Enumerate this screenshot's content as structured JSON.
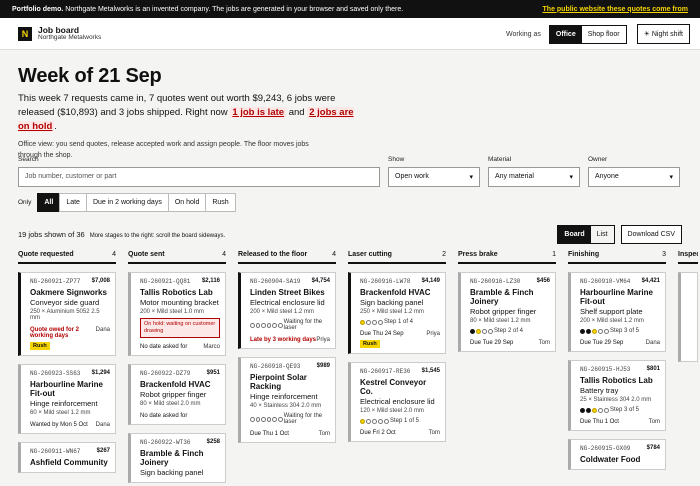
{
  "topbar": {
    "demo_bold": "Portfolio demo.",
    "demo_text": " Northgate Metalworks is an invented company. The jobs are generated in your browser and saved only there.",
    "public_link": "The public website these quotes come from"
  },
  "header": {
    "logo": "N",
    "title": "Job board",
    "subtitle": "Northgate Metalworks",
    "working_as": "Working as",
    "modes": [
      "Office",
      "Shop floor"
    ],
    "night": "☀ Night shift"
  },
  "page": {
    "title": "Week of 21 Sep",
    "summary_a": "This week 7 requests came in, 7 quotes went out worth $9,243, 6 jobs were released ($10,893) and 3 jobs shipped. Right now ",
    "late_flag": "1 job is late",
    "summary_and": " and ",
    "hold_flag": "2 jobs are on hold",
    "summary_end": ".",
    "note": "Office view: you send quotes, release accepted work and assign people. The floor moves jobs through the shop."
  },
  "filters": {
    "search_label": "Search",
    "search_placeholder": "Job number, customer or part",
    "show_label": "Show",
    "show_value": "Open work",
    "material_label": "Material",
    "material_value": "Any material",
    "owner_label": "Owner",
    "owner_value": "Anyone"
  },
  "only": {
    "label": "Only",
    "pills": [
      "All",
      "Late",
      "Due in 2 working days",
      "On hold",
      "Rush"
    ]
  },
  "count": {
    "text": "19 jobs shown of 36",
    "hint": "More stages to the right: scroll the board sideways."
  },
  "view": {
    "board": "Board",
    "list": "List",
    "export": "Download CSV"
  },
  "columns": [
    {
      "name": "Quote requested",
      "count": "4",
      "cards": [
        {
          "id": "NG-260921-ZP77",
          "price": "$7,008",
          "cust": "Oakmere Signworks",
          "desc": "Conveyor side guard",
          "mat": "250 × Aluminium 5052 2.5 mm",
          "late": "Quote owed for 2 working days",
          "who": "Dana",
          "rush": "Rush"
        },
        {
          "id": "NG-260923-SS63",
          "price": "$1,294",
          "cust": "Harbourline Marine Fit-out",
          "desc": "Hinge reinforcement",
          "mat": "60 × Mild steel 1.2 mm",
          "due": "Wanted by Mon 5 Oct",
          "who": "Dana"
        },
        {
          "id": "NG-260911-WN67",
          "price": "$267",
          "cust": "Ashfield Community",
          "desc": "",
          "mat": ""
        }
      ]
    },
    {
      "name": "Quote sent",
      "count": "4",
      "cards": [
        {
          "id": "NG-260921-QQ81",
          "price": "$2,116",
          "cust": "Tallis Robotics Lab",
          "desc": "Motor mounting bracket",
          "mat": "200 × Mild steel 1.0 mm",
          "due": "No date asked for",
          "who": "Marco",
          "hold": "On hold: waiting on customer drawing"
        },
        {
          "id": "NG-260922-DZ79",
          "price": "$951",
          "cust": "Brackenfold HVAC",
          "desc": "Robot gripper finger",
          "mat": "80 × Mild steel 2.0 mm",
          "due": "No date asked for"
        },
        {
          "id": "NG-260922-WT36",
          "price": "$258",
          "cust": "Bramble & Finch Joinery",
          "desc": "Sign backing panel",
          "mat": ""
        }
      ]
    },
    {
      "name": "Released to the floor",
      "count": "4",
      "cards": [
        {
          "id": "NG-260904-SA19",
          "price": "$4,754",
          "cust": "Linden Street Bikes",
          "desc": "Electrical enclosure lid",
          "mat": "200 × Mild steel 1.2 mm",
          "step": "Waiting for the laser",
          "dots": "oooooo",
          "late": "Late by 3 working days",
          "who": "Priya"
        },
        {
          "id": "NG-260918-QE93",
          "price": "$989",
          "cust": "Pierpoint Solar Racking",
          "desc": "Hinge reinforcement",
          "mat": "40 × Stainless 304 2.0 mm",
          "step": "Waiting for the laser",
          "dots": "oooooo",
          "due": "Due Thu 1 Oct",
          "who": "Tom"
        }
      ]
    },
    {
      "name": "Laser cutting",
      "count": "2",
      "cards": [
        {
          "id": "NG-260916-LW78",
          "price": "$4,149",
          "cust": "Brackenfold HVAC",
          "desc": "Sign backing panel",
          "mat": "250 × Mild steel 1.2 mm",
          "step": "Step 1 of 4",
          "dots": "yooo",
          "due": "Due Thu 24 Sep",
          "who": "Priya",
          "rush": "Rush"
        },
        {
          "id": "NG-260917-RE36",
          "price": "$1,545",
          "cust": "Kestrel Conveyor Co.",
          "desc": "Electrical enclosure lid",
          "mat": "120 × Mild steel 2.0 mm",
          "step": "Step 1 of 5",
          "dots": "yoooo",
          "due": "Due Fri 2 Oct",
          "who": "Tom"
        }
      ]
    },
    {
      "name": "Press brake",
      "count": "1",
      "cards": [
        {
          "id": "NG-260916-LZ30",
          "price": "$456",
          "cust": "Bramble & Finch Joinery",
          "desc": "Robot gripper finger",
          "mat": "80 × Mild steel 1.2 mm",
          "step": "Step 2 of 4",
          "dots": "fyoo",
          "due": "Due Tue 29 Sep",
          "who": "Tom"
        }
      ]
    },
    {
      "name": "Finishing",
      "count": "3",
      "cards": [
        {
          "id": "NG-260910-VM64",
          "price": "$4,421",
          "cust": "Harbourline Marine Fit-out",
          "desc": "Shelf support plate",
          "mat": "200 × Mild steel 1.2 mm",
          "step": "Step 3 of 5",
          "dots": "ffyoo",
          "due": "Due Tue 29 Sep",
          "who": "Dana"
        },
        {
          "id": "NG-260915-HJ53",
          "price": "$801",
          "cust": "Tallis Robotics Lab",
          "desc": "Battery tray",
          "mat": "25 × Stainless 304 2.0 mm",
          "step": "Step 3 of 5",
          "dots": "ffyoo",
          "due": "Due Thu 1 Oct",
          "who": "Tom"
        },
        {
          "id": "NG-260915-GX09",
          "price": "$784",
          "cust": "Coldwater Food",
          "desc": "",
          "mat": ""
        }
      ]
    }
  ],
  "stub": {
    "name": "Inspection"
  },
  "colors": {
    "accent": "#111111",
    "rush": "#f5d400",
    "late": "#b30000"
  }
}
